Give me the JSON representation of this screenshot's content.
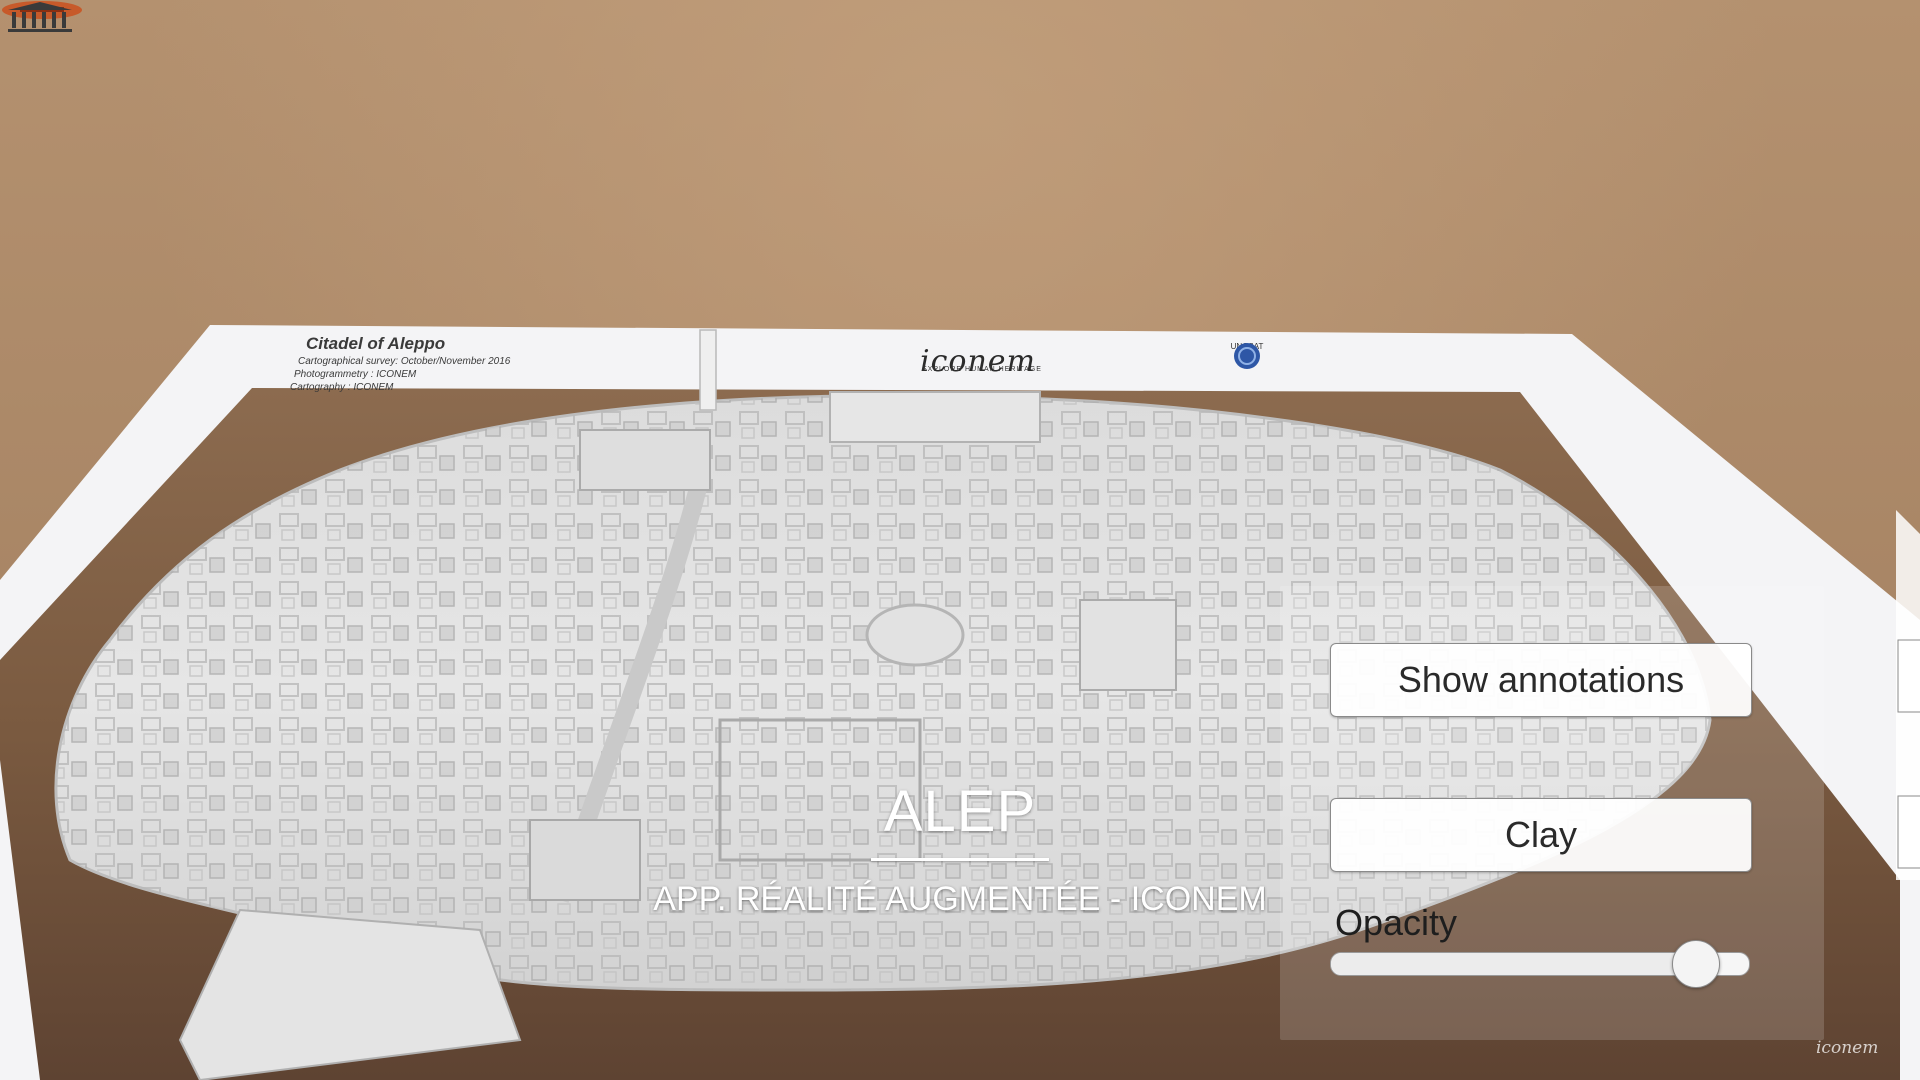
{
  "sheet": {
    "title": "Citadel of Aleppo",
    "lines": [
      "Cartographical survey: October/November 2016",
      "Photogrammetry : ICONEM",
      "Cartography : ICONEM"
    ],
    "logos": {
      "iconem": "iconem",
      "iconem_tagline": "EXPLORE HUMAN HERITAGE",
      "unosat": "UNOSAT"
    }
  },
  "overlay": {
    "title": "ALEP",
    "subtitle": "APP. RÉALITÉ AUGMENTÉE - ICONEM"
  },
  "panel": {
    "annotations_button": "Show annotations",
    "clay_button": "Clay",
    "opacity_label": "Opacity",
    "opacity_value": 0.92
  },
  "watermark": "iconem",
  "colors": {
    "sand": "#b08a6a",
    "model": "#e9e9e9",
    "button_bg": "#ffffff",
    "text_overlay": "#ffffff"
  }
}
